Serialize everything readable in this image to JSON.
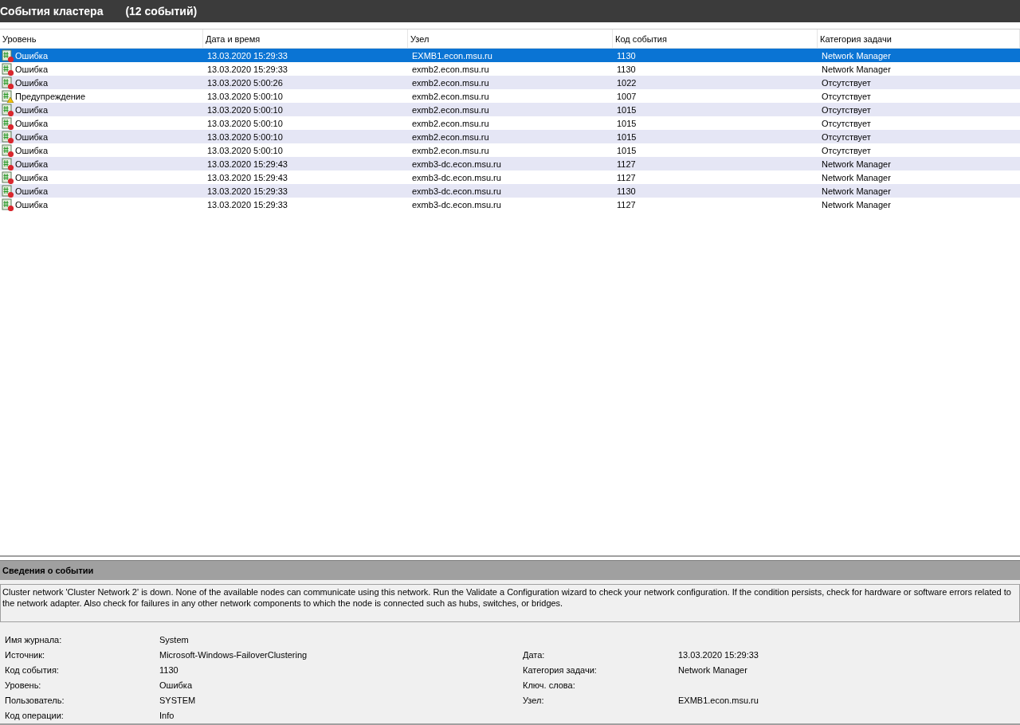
{
  "header": {
    "title": "События кластера",
    "count": "(12 событий)"
  },
  "table": {
    "columns": [
      "Уровень",
      "Дата и время",
      "Узел",
      "Код события",
      "Категория задачи"
    ],
    "rows": [
      {
        "kind": "error",
        "selected": true,
        "cells": [
          "Ошибка",
          "13.03.2020 15:29:33",
          "EXMB1.econ.msu.ru",
          "1130",
          "Network Manager"
        ]
      },
      {
        "kind": "error",
        "selected": false,
        "cells": [
          "Ошибка",
          "13.03.2020 15:29:33",
          "exmb2.econ.msu.ru",
          "1130",
          "Network Manager"
        ]
      },
      {
        "kind": "error",
        "selected": false,
        "cells": [
          "Ошибка",
          "13.03.2020 5:00:26",
          "exmb2.econ.msu.ru",
          "1022",
          "Отсутствует"
        ]
      },
      {
        "kind": "warning",
        "selected": false,
        "cells": [
          "Предупреждение",
          "13.03.2020 5:00:10",
          "exmb2.econ.msu.ru",
          "1007",
          "Отсутствует"
        ]
      },
      {
        "kind": "error",
        "selected": false,
        "cells": [
          "Ошибка",
          "13.03.2020 5:00:10",
          "exmb2.econ.msu.ru",
          "1015",
          "Отсутствует"
        ]
      },
      {
        "kind": "error",
        "selected": false,
        "cells": [
          "Ошибка",
          "13.03.2020 5:00:10",
          "exmb2.econ.msu.ru",
          "1015",
          "Отсутствует"
        ]
      },
      {
        "kind": "error",
        "selected": false,
        "cells": [
          "Ошибка",
          "13.03.2020 5:00:10",
          "exmb2.econ.msu.ru",
          "1015",
          "Отсутствует"
        ]
      },
      {
        "kind": "error",
        "selected": false,
        "cells": [
          "Ошибка",
          "13.03.2020 5:00:10",
          "exmb2.econ.msu.ru",
          "1015",
          "Отсутствует"
        ]
      },
      {
        "kind": "error",
        "selected": false,
        "cells": [
          "Ошибка",
          "13.03.2020 15:29:43",
          "exmb3-dc.econ.msu.ru",
          "1127",
          "Network Manager"
        ]
      },
      {
        "kind": "error",
        "selected": false,
        "cells": [
          "Ошибка",
          "13.03.2020 15:29:43",
          "exmb3-dc.econ.msu.ru",
          "1127",
          "Network Manager"
        ]
      },
      {
        "kind": "error",
        "selected": false,
        "cells": [
          "Ошибка",
          "13.03.2020 15:29:33",
          "exmb3-dc.econ.msu.ru",
          "1130",
          "Network Manager"
        ]
      },
      {
        "kind": "error",
        "selected": false,
        "cells": [
          "Ошибка",
          "13.03.2020 15:29:33",
          "exmb3-dc.econ.msu.ru",
          "1127",
          "Network Manager"
        ]
      }
    ]
  },
  "details": {
    "title": "Сведения о событии",
    "description": "Cluster network 'Cluster Network 2' is down. None of the available nodes can communicate using this network. Run the Validate a Configuration wizard to check your network configuration. If the condition persists, check for hardware or software errors related to the network adapter. Also check for failures in any other network components to which the node is connected such as hubs, switches, or bridges.",
    "left": [
      {
        "label": "Имя журнала:",
        "value": "System"
      },
      {
        "label": "Источник:",
        "value": "Microsoft-Windows-FailoverClustering"
      },
      {
        "label": "Код события:",
        "value": "1130"
      },
      {
        "label": "Уровень:",
        "value": "Ошибка"
      },
      {
        "label": "Пользователь:",
        "value": "SYSTEM"
      },
      {
        "label": "Код операции:",
        "value": "Info"
      }
    ],
    "right": [
      {
        "label": "Дата:",
        "value": "13.03.2020 15:29:33"
      },
      {
        "label": "Категория задачи:",
        "value": "Network Manager"
      },
      {
        "label": "Ключ. слова:"
      },
      {
        "label": "Узел:",
        "value": "EXMB1.econ.msu.ru"
      }
    ]
  }
}
